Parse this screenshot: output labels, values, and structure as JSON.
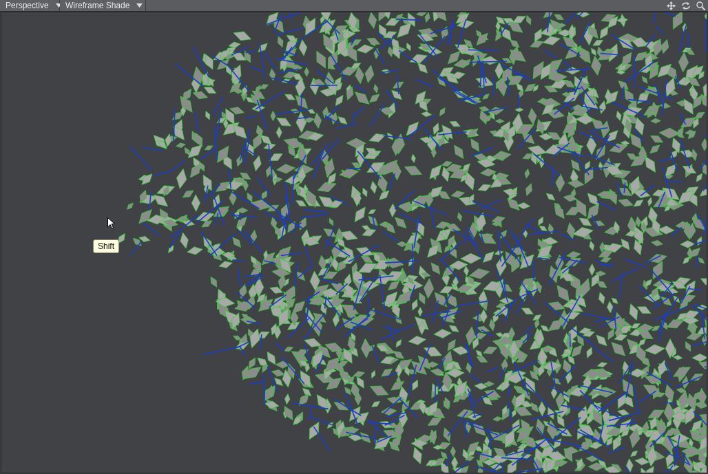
{
  "viewport": {
    "view_menu": {
      "label": "Perspective"
    },
    "shading_menu": {
      "label": "Wireframe Shade"
    },
    "tooltip": {
      "text": "Shift"
    }
  }
}
